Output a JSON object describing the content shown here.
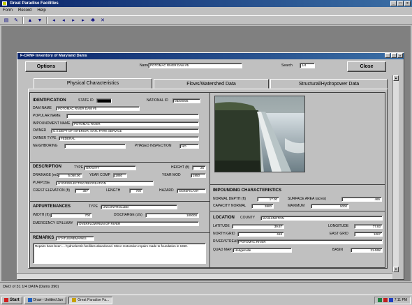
{
  "app": {
    "title": "Great Paradise Facilities",
    "menu": [
      "Form",
      "Record",
      "Help"
    ]
  },
  "form": {
    "title": "F-CRNF Inventory of Maryland Dams",
    "options_label": "Options",
    "name_label": "Name",
    "name_value": "POTOMAC RIVER DAM #5",
    "search_label": "Search",
    "search_value": "1/4",
    "close_label": "Close"
  },
  "tabs": [
    "Physical Characteristics",
    "Flows/Watershed Data",
    "Structural/Hydropower Data"
  ],
  "identification": {
    "heading": "IDENTIFICATION",
    "state_id_label": "STATE ID",
    "state_id_value": "",
    "national_id_label": "NATIONAL ID",
    "national_id_value": "MD00006",
    "dam_name_label": "DAM NAME",
    "dam_name_value": "POTOMAC RIVER DAM #5",
    "popular_name_label": "POPULAR NAME",
    "popular_name_value": "",
    "impoundment_label": "IMPOUNDMENT NAME",
    "impoundment_value": "POTOMAC RIVER",
    "owner_label": "OWNER",
    "owner_value": "U.S.DEPT OF INTERIOR, NATL PARK SERVICE",
    "owner_type_label": "OWNER TYPE",
    "owner_type_value": "FEDERAL",
    "additional_label": "NEIGHBORING",
    "additional_value": "",
    "phased_label": "PHASED INSPECTION",
    "phased_value": "NO"
  },
  "description": {
    "heading": "DESCRIPTION",
    "type_label": "TYPE",
    "type_value": "GRAVITY",
    "height_label": "HEIGHT (ft)",
    "height_value": "25",
    "drainage_label": "DRAINAGE (mi2)",
    "drainage_value": "5,060.00",
    "year_comp_label": "YEAR COMP",
    "year_comp_value": "1860",
    "year_mod_label": "YEAR MOD",
    "year_mod_value": "1950",
    "purpose_label": "PURPOSE",
    "purpose_value": "HYDROELECTRIC/RECREATION",
    "crest_label": "CREST ELEVATION (ft)",
    "crest_value": "387",
    "length_label": "LENGTH",
    "length_value": "700",
    "hazard_label": "HAZARD",
    "hazard_value": "SIGNIFICANT"
  },
  "appurtenances": {
    "heading": "APPURTENANCES",
    "type_label": "TYPE",
    "type_value": "UNCONTROLLED",
    "width_label": "WIDTH (ft)",
    "width_value": "700",
    "discharge_label": "DISCHARGE (cfs)",
    "discharge_value": "180000",
    "emergency_label": "EMERGENCY SPILLWAY",
    "emergency_value": "OVERFLOW/RUN OF RIVER"
  },
  "remarks": {
    "heading": "REMARKS",
    "tag": "STATUS/REMARKS",
    "text": "Repairs have been ... hydroelectric facilities abandoned. Minor restoration repairs made to foundation in 1960."
  },
  "impounding": {
    "heading": "IMPOUNDING CHARACTERISTICS",
    "normal_depth_label": "NORMAL DEPTH (ft)",
    "normal_depth_value": "17.00",
    "surface_area_label": "SURFACE AREA (acres)",
    "surface_area_value": "465",
    "capacity_label": "CAPACITY NORMAL",
    "capacity_value": "3800",
    "maximum_label": "MAXIMUM",
    "maximum_value": "5000"
  },
  "location": {
    "heading": "LOCATION",
    "county_label": "COUNTY",
    "county_value": "WASHINGTON",
    "latitude_label": "LATITUDE",
    "latitude_value": "39.67",
    "longitude_label": "LONGITUDE",
    "longitude_value": "77.83",
    "north_grid_label": "NORTH GRID",
    "north_grid_value": "618",
    "east_grid_label": "EAST GRID",
    "east_grid_value": "1067",
    "river_label": "RIVER/STREAM",
    "river_value": "POTOMAC RIVER",
    "quad_label": "QUAD MAP",
    "quad_value": "Hedgesville",
    "basin_label": "BASIN",
    "basin_value": "21-MW"
  },
  "status_text": "DEO of 31 1/4 DATA (Dams 390)",
  "taskbar": {
    "start": "Start",
    "tasks": [
      "Draw - Untitled Jun",
      "Great Paradise Fa..."
    ],
    "clock": "7:11 PM"
  }
}
